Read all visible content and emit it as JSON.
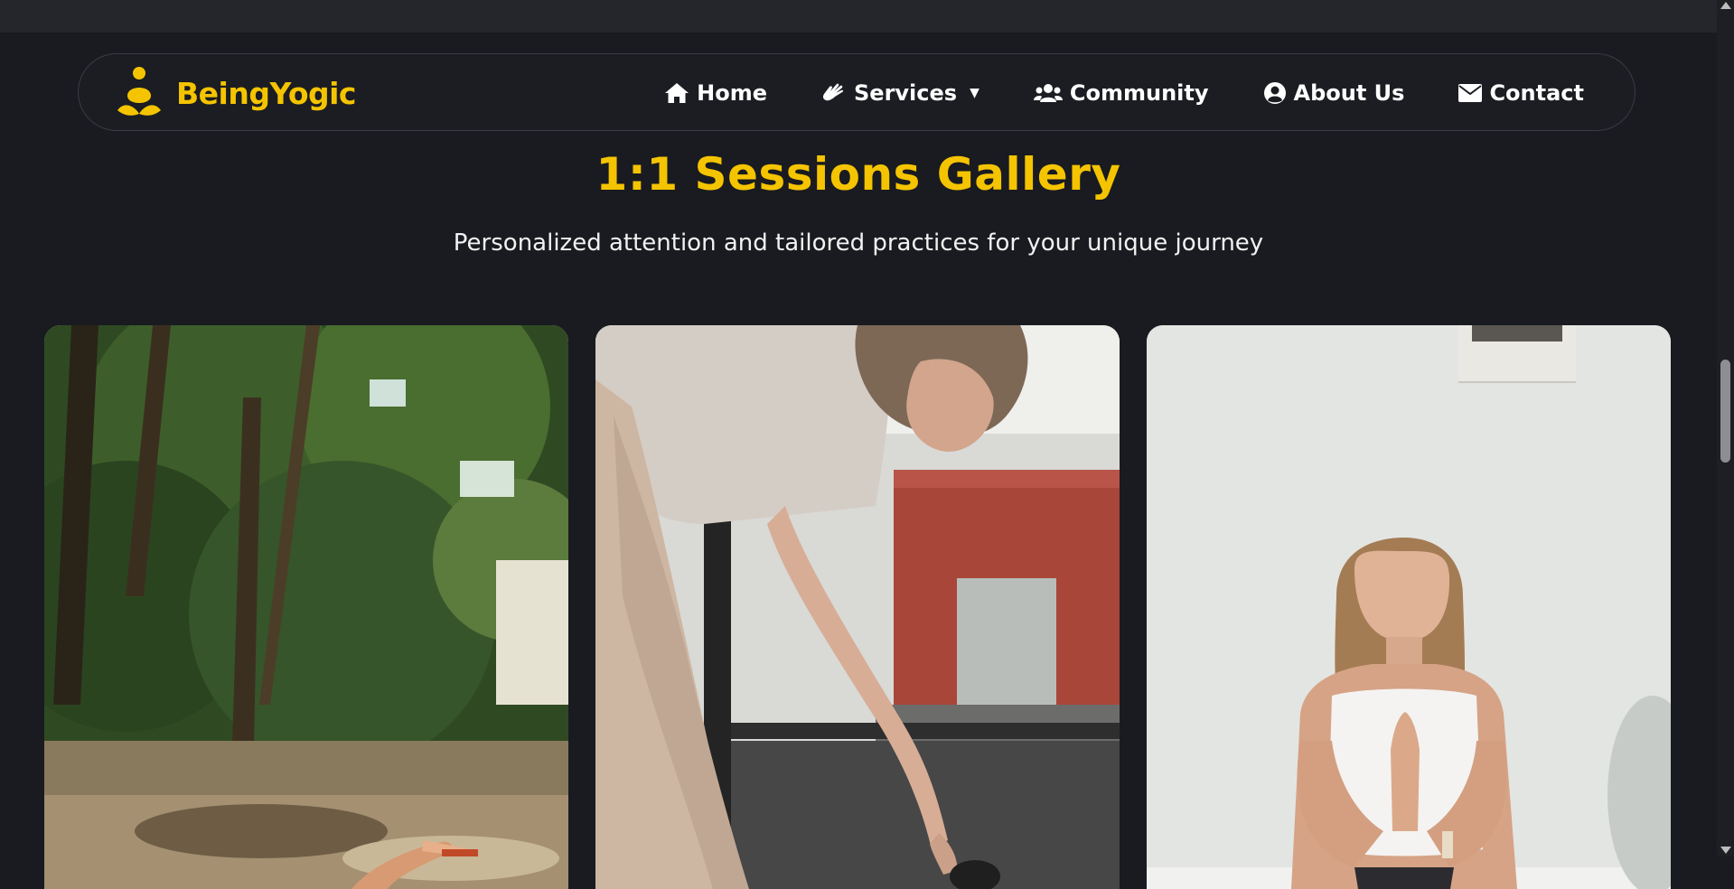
{
  "brand": {
    "name": "BeingYogic",
    "logo_icon": "meditating-person-icon",
    "color": "#f5c400"
  },
  "nav": {
    "items": [
      {
        "label": "Home",
        "icon": "home-icon"
      },
      {
        "label": "Services",
        "icon": "hand-sign-icon",
        "dropdown": true
      },
      {
        "label": "Community",
        "icon": "users-icon"
      },
      {
        "label": "About Us",
        "icon": "user-circle-icon"
      },
      {
        "label": "Contact",
        "icon": "envelope-icon"
      }
    ],
    "caret": "▼"
  },
  "section": {
    "title": "1:1 Sessions Gallery",
    "subtitle": "Personalized attention and tailored practices for your unique journey"
  },
  "gallery": {
    "photos": [
      {
        "subject": "outdoor-yoga-under-trees"
      },
      {
        "subject": "woman-stretching-forward-bend"
      },
      {
        "subject": "woman-meditating-prayer-hands"
      }
    ]
  },
  "colors": {
    "background": "#191b20",
    "accent": "#f5c400",
    "text": "#ffffff"
  }
}
